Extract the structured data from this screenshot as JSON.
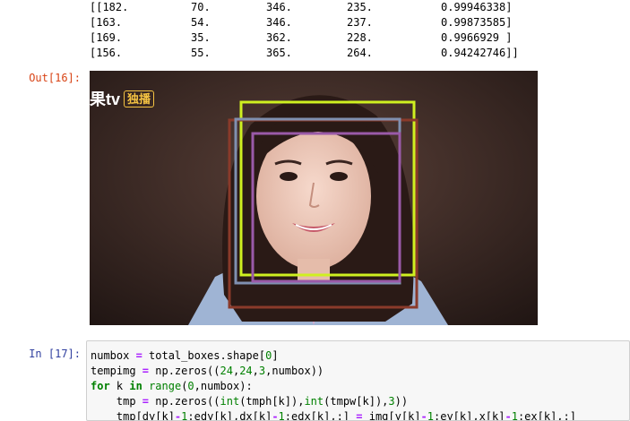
{
  "output_rows": [
    [
      "[[182.",
      "70.",
      "346.",
      "235.",
      "0.99946338]"
    ],
    [
      "[163.",
      "54.",
      "346.",
      "237.",
      "0.99873585]"
    ],
    [
      "[169.",
      "35.",
      "362.",
      "228.",
      "0.9966929 ]"
    ],
    [
      "[156.",
      "55.",
      "365.",
      "264.",
      "0.94242746]]"
    ]
  ],
  "out_prompt": "Out[16]:",
  "in_prompt": "In [17]:",
  "image": {
    "logo_text": "果tv",
    "logo_badge": "独播",
    "box_colors": [
      "#cff020",
      "#8a3a2a",
      "#8090b0",
      "#9a5aa8"
    ]
  },
  "code_lines": [
    "numbox = total_boxes.shape[0]",
    "tempimg = np.zeros((24,24,3,numbox))",
    "for k in range(0,numbox):",
    "    tmp = np.zeros((int(tmph[k]),int(tmpw[k]),3))",
    "    tmp[dy[k]-1:edy[k],dx[k]-1:edx[k],:] = img[y[k]-1:ey[k],x[k]-1:ex[k],:]"
  ]
}
